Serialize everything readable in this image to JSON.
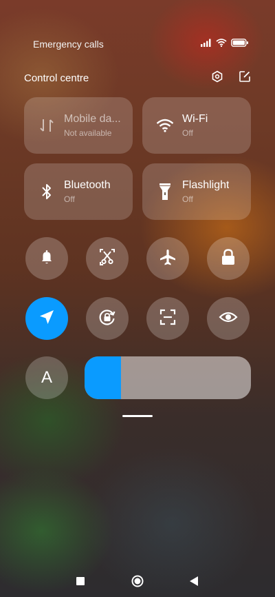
{
  "status_bar": {
    "carrier_text": "Emergency calls",
    "icons": [
      "signal-icon",
      "wifi-icon",
      "battery-icon"
    ]
  },
  "header": {
    "title": "Control centre",
    "icons": [
      "settings-icon",
      "edit-icon"
    ]
  },
  "tiles": [
    {
      "id": "mobile-data",
      "label": "Mobile da...",
      "status": "Not available",
      "icon": "mobile-data-icon"
    },
    {
      "id": "wifi",
      "label": "Wi-Fi",
      "status": "Off",
      "icon": "wifi-icon"
    },
    {
      "id": "bluetooth",
      "label": "Bluetooth",
      "status": "Off",
      "icon": "bluetooth-icon"
    },
    {
      "id": "flashlight",
      "label": "Flashlight",
      "status": "Off",
      "icon": "flashlight-icon"
    }
  ],
  "toggles": [
    {
      "id": "silent",
      "icon": "bell-icon",
      "active": false
    },
    {
      "id": "screenshot",
      "icon": "screenshot-scissors-icon",
      "active": false
    },
    {
      "id": "airplane",
      "icon": "airplane-icon",
      "active": false
    },
    {
      "id": "lock-screen",
      "icon": "lock-icon",
      "active": false
    },
    {
      "id": "location",
      "icon": "location-arrow-icon",
      "active": true
    },
    {
      "id": "rotation-lock",
      "icon": "rotation-lock-icon",
      "active": false
    },
    {
      "id": "scanner",
      "icon": "scan-frame-icon",
      "active": false
    },
    {
      "id": "reading-mode",
      "icon": "eye-icon",
      "active": false
    }
  ],
  "auto_brightness": {
    "label": "A"
  },
  "brightness": {
    "level_percent": 22
  },
  "colors": {
    "accent": "#0a9bff"
  },
  "nav_bar": {
    "icons": [
      "recents-square-icon",
      "home-circle-icon",
      "back-triangle-icon"
    ]
  }
}
